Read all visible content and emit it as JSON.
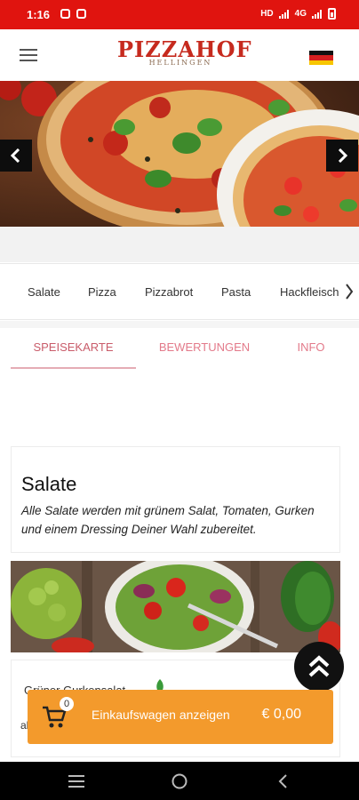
{
  "status_bar": {
    "time": "1:16",
    "network": "4G",
    "background_color": "#e0140f"
  },
  "header": {
    "menu_icon": "hamburger-icon",
    "logo_title": "PIZZAHOF",
    "logo_subtitle": "HELLINGEN",
    "language_flag": "germany-flag-icon",
    "logo_color": "#c62a1e"
  },
  "hero": {
    "prev_icon": "chevron-left-icon",
    "next_icon": "chevron-right-icon"
  },
  "categories": {
    "items": [
      "Salate",
      "Pizza",
      "Pizzabrot",
      "Pasta",
      "Hackfleisch"
    ],
    "more_icon": "chevron-right-icon"
  },
  "tabs": [
    {
      "label": "SPEISEKARTE",
      "active": true
    },
    {
      "label": "BEWERTUNGEN",
      "active": false
    },
    {
      "label": "INFO",
      "active": false
    }
  ],
  "section": {
    "title": "Salate",
    "description": "Alle Salate werden mit grünem Salat, Tomaten, Gurken und einem Dressing Deiner Wahl zubereitet."
  },
  "menu_item": {
    "name": "Grüner Gurkensalat",
    "badge_icon": "vegetarian-leaf-icon",
    "price_prefix": "ab"
  },
  "scroll_top": {
    "icon": "double-chevron-up-icon"
  },
  "cart": {
    "count": "0",
    "label": "Einkaufswagen anzeigen",
    "total": "€ 0,00",
    "color": "#f39a2c"
  },
  "nav_bar": {
    "recents_icon": "recents-icon",
    "home_icon": "home-circle-icon",
    "back_icon": "back-chevron-icon"
  }
}
